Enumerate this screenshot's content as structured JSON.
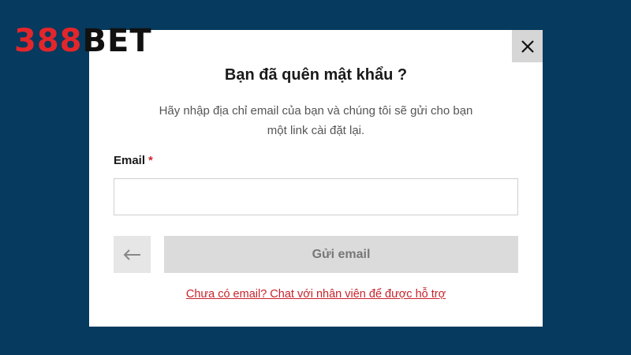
{
  "logo": {
    "number": "388",
    "word": "BET"
  },
  "colors": {
    "background": "#063a5e",
    "brand_red": "#e3262b",
    "link_red": "#c8232b",
    "button_gray": "#dbdbdb"
  },
  "modal": {
    "title": "Bạn đã quên mật khẩu ?",
    "description_line1": "Hãy nhập địa chỉ email của bạn và chúng tôi sẽ gửi cho bạn",
    "description_line2": "một link cài đặt lại.",
    "email_label": "Email",
    "required_mark": "*",
    "email_value": "",
    "send_button_label": "Gửi email",
    "help_link": "Chưa có email? Chat với nhân viên để được hỗ trợ",
    "close_icon": "close-icon",
    "back_icon": "arrow-left-icon"
  }
}
